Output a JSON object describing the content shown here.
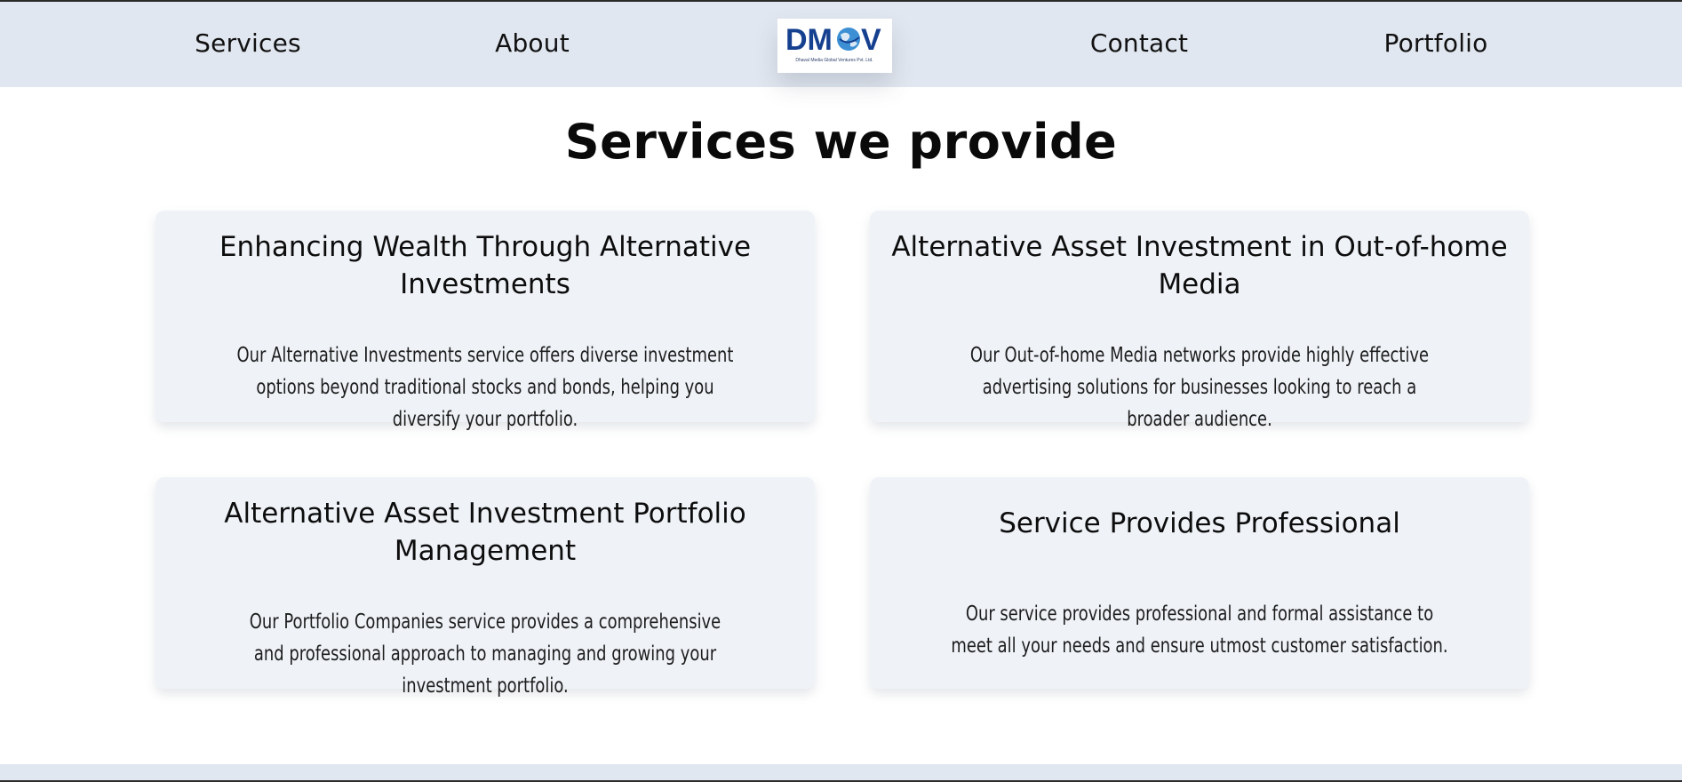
{
  "nav": {
    "services": "Services",
    "about": "About",
    "contact": "Contact",
    "portfolio": "Portfolio"
  },
  "logo": {
    "wordmark": "DMGV",
    "tagline": "Dhaval Media Global Ventures Pvt. Ltd.",
    "color_primary": "#153f8f",
    "color_globe": "#3d8fd4"
  },
  "main": {
    "title": "Services we provide",
    "cards": [
      {
        "title": "Enhancing Wealth Through Alternative Investments",
        "text": "Our Alternative Investments service offers diverse investment options beyond traditional stocks and bonds, helping you diversify your portfolio."
      },
      {
        "title": "Alternative Asset Investment in Out-of-home Media",
        "text": "Our Out-of-home Media networks provide highly effective advertising solutions for businesses looking to reach a broader audience."
      },
      {
        "title": "Alternative Asset Investment Portfolio Management",
        "text": "Our Portfolio Companies service provides a comprehensive and professional approach to managing and growing your investment portfolio."
      },
      {
        "title": "Service Provides Professional",
        "text": "Our service provides professional and formal assistance to meet all your needs and ensure utmost customer satisfaction."
      }
    ]
  },
  "colors": {
    "nav_background": "#e1e7f0",
    "card_background": "#eff3f8",
    "text": "#111111"
  }
}
